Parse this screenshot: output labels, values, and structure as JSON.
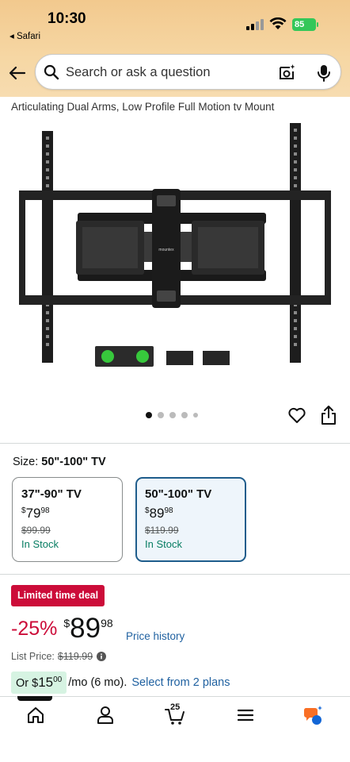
{
  "status": {
    "time": "10:30",
    "back_app": "◂ Safari",
    "battery": "85"
  },
  "search": {
    "placeholder": "Search or ask a question"
  },
  "product": {
    "title": "Articulating Dual Arms, Low Profile Full Motion tv Mount",
    "brand_logo": "mountex",
    "gallery_dots": 5,
    "active_dot": 0
  },
  "size": {
    "label": "Size:",
    "selected": "50\"-100\" TV",
    "options": [
      {
        "name": "37\"-90\" TV",
        "currency": "$",
        "whole": "79",
        "fraction": "98",
        "list_price": "$99.99",
        "stock": "In Stock",
        "selected": false
      },
      {
        "name": "50\"-100\" TV",
        "currency": "$",
        "whole": "89",
        "fraction": "98",
        "list_price": "$119.99",
        "stock": "In Stock",
        "selected": true
      }
    ]
  },
  "deal": {
    "badge": "Limited time deal",
    "discount": "-25%",
    "currency": "$",
    "whole": "89",
    "fraction": "98",
    "price_history": "Price history",
    "list_price_label": "List Price:",
    "list_price": "$119.99"
  },
  "plan": {
    "prefix": "Or $",
    "whole": "15",
    "fraction": "00",
    "term": "/mo (6 mo).",
    "link": "Select from 2 plans"
  },
  "tabs": {
    "cart_count": "25"
  },
  "colors": {
    "deal_red": "#cc0c39",
    "link_blue": "#2162a1",
    "stock_green": "#067d62",
    "selected_border": "#1f5d8c"
  }
}
